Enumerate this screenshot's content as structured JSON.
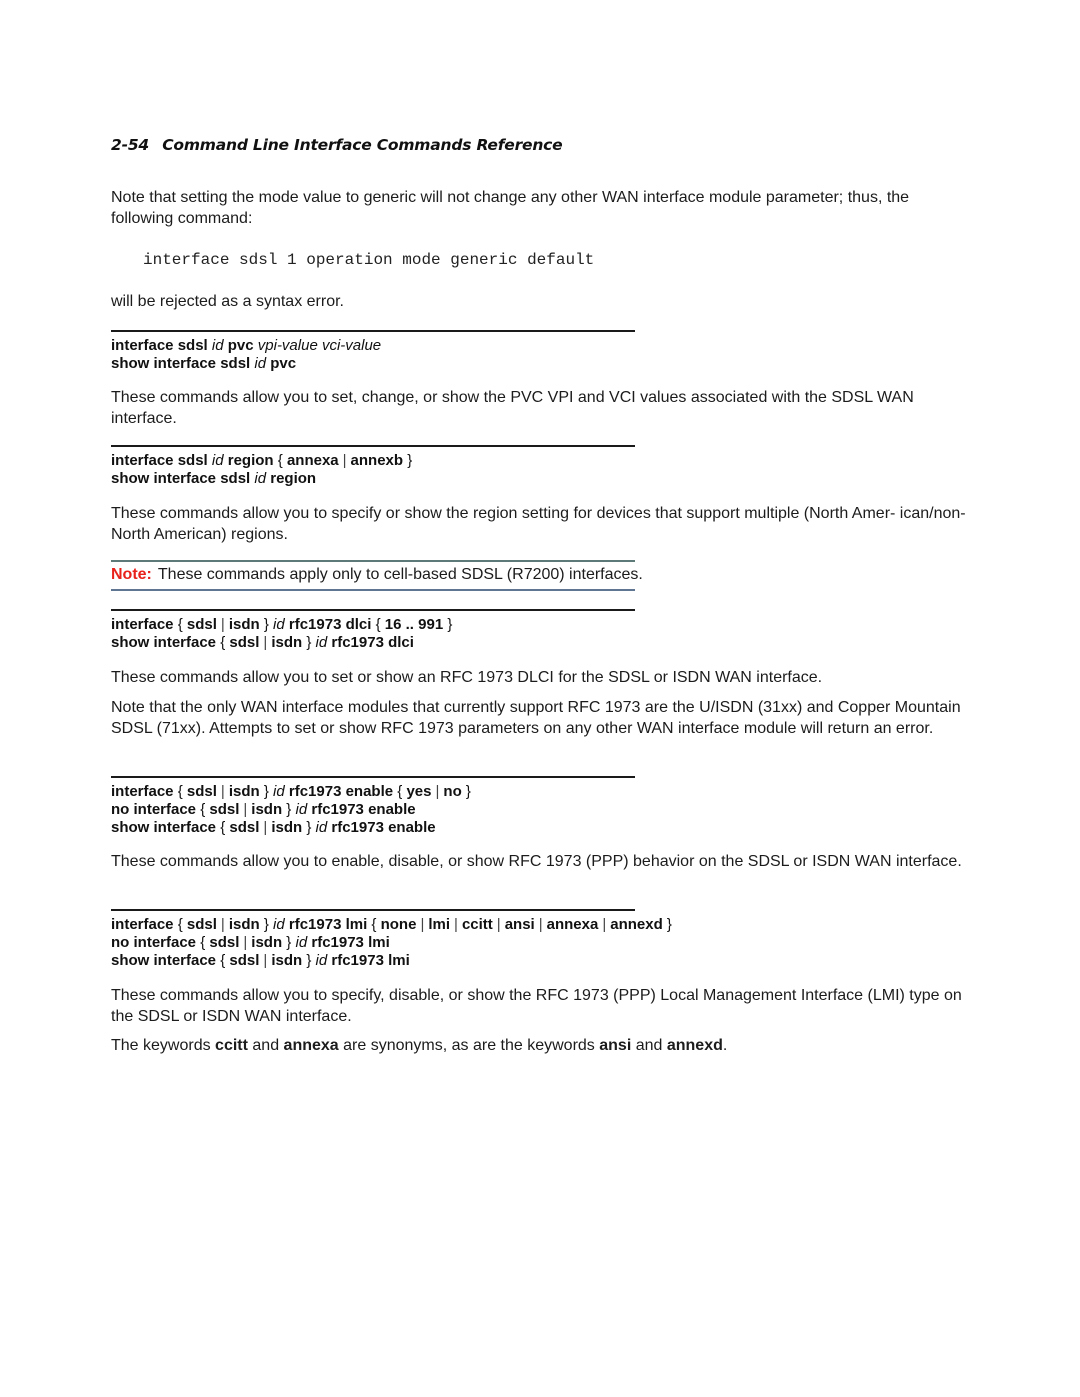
{
  "header": {
    "page_number": "2-54",
    "title": "Command Line Interface Commands Reference"
  },
  "intro": {
    "paragraph": "Note that setting the mode value to generic will not change any other WAN interface module parameter; thus, the following command:",
    "code": "interface sdsl 1 operation mode generic default",
    "after_code": "will be rejected as a syntax error."
  },
  "sections": [
    {
      "commands": [
        [
          {
            "t": "interface sdsl ",
            "s": "b"
          },
          {
            "t": "id",
            "s": "i"
          },
          {
            "t": " pvc ",
            "s": "b"
          },
          {
            "t": "vpi-value vci-value",
            "s": "i"
          }
        ],
        [
          {
            "t": "show interface sdsl ",
            "s": "b"
          },
          {
            "t": "id",
            "s": "i"
          },
          {
            "t": " pvc",
            "s": "b"
          }
        ]
      ],
      "paragraphs": [
        "These commands allow you to set, change, or show the PVC VPI and VCI values associated with the SDSL WAN interface."
      ]
    },
    {
      "commands": [
        [
          {
            "t": "interface sdsl ",
            "s": "b"
          },
          {
            "t": "id",
            "s": "i"
          },
          {
            "t": " region ",
            "s": "b"
          },
          {
            "t": "{ ",
            "s": "n"
          },
          {
            "t": "annexa",
            "s": "b"
          },
          {
            "t": " |  ",
            "s": "p"
          },
          {
            "t": "annexb",
            "s": "b"
          },
          {
            "t": " }",
            "s": "n"
          }
        ],
        [
          {
            "t": "show interface sdsl ",
            "s": "b"
          },
          {
            "t": "id",
            "s": "i"
          },
          {
            "t": " region",
            "s": "b"
          }
        ]
      ],
      "paragraphs": [
        "These commands allow you to specify or show the region setting for devices that support multiple (North Amer- ican/non-North American) regions."
      ],
      "note": {
        "label": "Note:",
        "text": "These commands apply only to cell-based SDSL (R7200) interfaces."
      }
    },
    {
      "commands": [
        [
          {
            "t": "interface ",
            "s": "b"
          },
          {
            "t": "{ ",
            "s": "n"
          },
          {
            "t": "sdsl",
            "s": "b"
          },
          {
            "t": " | ",
            "s": "p"
          },
          {
            "t": "isdn",
            "s": "b"
          },
          {
            "t": " } ",
            "s": "n"
          },
          {
            "t": "id",
            "s": "i"
          },
          {
            "t": " rfc1973 dlci ",
            "s": "b"
          },
          {
            "t": "{ ",
            "s": "n"
          },
          {
            "t": "16 .. 991",
            "s": "b"
          },
          {
            "t": " }",
            "s": "n"
          }
        ],
        [
          {
            "t": "show interface ",
            "s": "b"
          },
          {
            "t": "{ ",
            "s": "n"
          },
          {
            "t": "sdsl",
            "s": "b"
          },
          {
            "t": " | ",
            "s": "p"
          },
          {
            "t": "isdn",
            "s": "b"
          },
          {
            "t": " } ",
            "s": "n"
          },
          {
            "t": "id",
            "s": "i"
          },
          {
            "t": " rfc1973 dlci",
            "s": "b"
          }
        ]
      ],
      "paragraphs": [
        "These commands allow you to set or show an RFC 1973 DLCI for the SDSL or ISDN WAN interface.",
        "Note that the only WAN interface modules that currently support RFC 1973 are the U/ISDN (31xx) and Copper Mountain SDSL (71xx). Attempts to set or show RFC 1973 parameters on any other WAN interface module will return an error."
      ]
    },
    {
      "commands": [
        [
          {
            "t": "interface ",
            "s": "b"
          },
          {
            "t": "{ ",
            "s": "n"
          },
          {
            "t": "sdsl",
            "s": "b"
          },
          {
            "t": " | ",
            "s": "p"
          },
          {
            "t": "isdn",
            "s": "b"
          },
          {
            "t": " } ",
            "s": "n"
          },
          {
            "t": "id",
            "s": "i"
          },
          {
            "t": " rfc1973 enable ",
            "s": "b"
          },
          {
            "t": "{ ",
            "s": "n"
          },
          {
            "t": "yes",
            "s": "b"
          },
          {
            "t": " | ",
            "s": "p"
          },
          {
            "t": "no",
            "s": "b"
          },
          {
            "t": " }",
            "s": "n"
          }
        ],
        [
          {
            "t": "no interface ",
            "s": "b"
          },
          {
            "t": "{ ",
            "s": "n"
          },
          {
            "t": "sdsl",
            "s": "b"
          },
          {
            "t": " | ",
            "s": "p"
          },
          {
            "t": "isdn",
            "s": "b"
          },
          {
            "t": " } ",
            "s": "n"
          },
          {
            "t": "id",
            "s": "i"
          },
          {
            "t": " rfc1973 enable",
            "s": "b"
          }
        ],
        [
          {
            "t": "show interface ",
            "s": "b"
          },
          {
            "t": "{ ",
            "s": "n"
          },
          {
            "t": "sdsl",
            "s": "b"
          },
          {
            "t": " | ",
            "s": "p"
          },
          {
            "t": "isdn",
            "s": "b"
          },
          {
            "t": "  } ",
            "s": "n"
          },
          {
            "t": "id",
            "s": "i"
          },
          {
            "t": " rfc1973 enable",
            "s": "b"
          }
        ]
      ],
      "paragraphs": [
        "These commands allow you to enable, disable, or show RFC 1973 (PPP) behavior on the SDSL or ISDN WAN interface."
      ]
    },
    {
      "commands": [
        [
          {
            "t": "interface ",
            "s": "b"
          },
          {
            "t": "{ ",
            "s": "n"
          },
          {
            "t": "sdsl",
            "s": "b"
          },
          {
            "t": " | ",
            "s": "p"
          },
          {
            "t": "isdn",
            "s": "b"
          },
          {
            "t": " } ",
            "s": "n"
          },
          {
            "t": "id",
            "s": "i"
          },
          {
            "t": " rfc1973 lmi ",
            "s": "b"
          },
          {
            "t": "{ ",
            "s": "n"
          },
          {
            "t": "none",
            "s": "b"
          },
          {
            "t": " | ",
            "s": "p"
          },
          {
            "t": "lmi",
            "s": "b"
          },
          {
            "t": " | ",
            "s": "p"
          },
          {
            "t": "ccitt",
            "s": "b"
          },
          {
            "t": " | ",
            "s": "p"
          },
          {
            "t": "ansi",
            "s": "b"
          },
          {
            "t": " | ",
            "s": "p"
          },
          {
            "t": "annexa",
            "s": "b"
          },
          {
            "t": " | ",
            "s": "p"
          },
          {
            "t": "annexd",
            "s": "b"
          },
          {
            "t": " }",
            "s": "n"
          }
        ],
        [
          {
            "t": "no interface ",
            "s": "b"
          },
          {
            "t": "{ ",
            "s": "n"
          },
          {
            "t": "sdsl",
            "s": "b"
          },
          {
            "t": " | ",
            "s": "p"
          },
          {
            "t": "isdn",
            "s": "b"
          },
          {
            "t": " } ",
            "s": "n"
          },
          {
            "t": "id",
            "s": "i"
          },
          {
            "t": " rfc1973 lmi",
            "s": "b"
          }
        ],
        [
          {
            "t": "show interface ",
            "s": "b"
          },
          {
            "t": "{ ",
            "s": "n"
          },
          {
            "t": "sdsl",
            "s": "b"
          },
          {
            "t": " | ",
            "s": "p"
          },
          {
            "t": "isdn",
            "s": "b"
          },
          {
            "t": " } ",
            "s": "n"
          },
          {
            "t": "id",
            "s": "i"
          },
          {
            "t": " rfc1973 lmi",
            "s": "b"
          }
        ]
      ],
      "paragraphs": [
        "These commands allow you to specify, disable, or show the RFC 1973 (PPP) Local Management Interface (LMI) type on the SDSL or ISDN WAN interface."
      ],
      "rich_paragraph": [
        {
          "t": "The keywords ",
          "s": "n"
        },
        {
          "t": "ccitt",
          "s": "b"
        },
        {
          "t": " and ",
          "s": "n"
        },
        {
          "t": "annexa",
          "s": "b"
        },
        {
          "t": " are synonyms, as are the keywords ",
          "s": "n"
        },
        {
          "t": "ansi",
          "s": "b"
        },
        {
          "t": " and ",
          "s": "n"
        },
        {
          "t": "annexd",
          "s": "b"
        },
        {
          "t": ".",
          "s": "n"
        }
      ]
    }
  ],
  "colors": {
    "note_label": "#e8221b",
    "note_rule_top": "#5e7a78",
    "note_rule_bottom": "#5f7592",
    "rule": "#1a1a1a"
  }
}
